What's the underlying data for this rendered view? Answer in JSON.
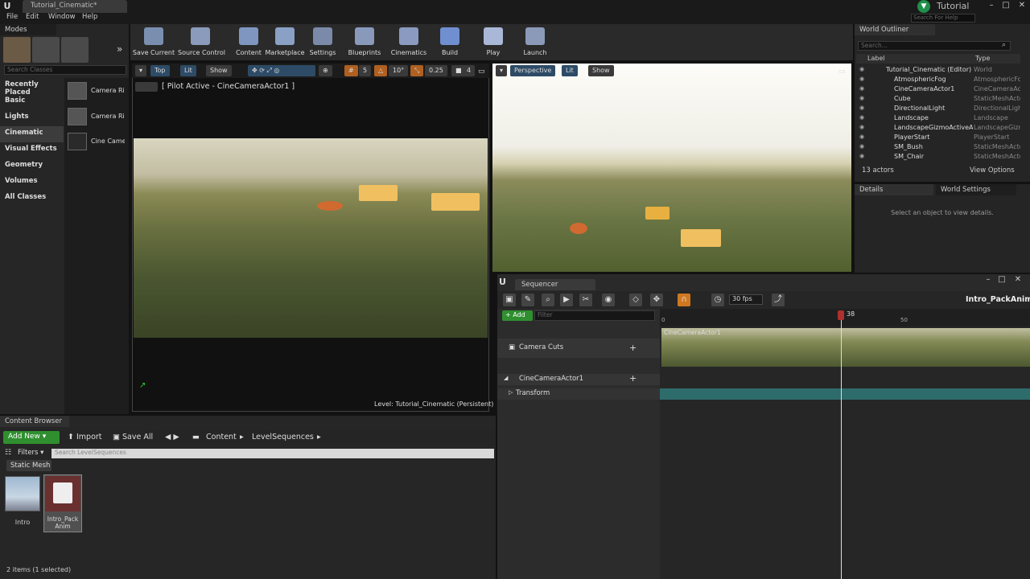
{
  "window": {
    "doc_tab": "Tutorial_Cinematic*",
    "project": "Tutorial",
    "help_search": "Search For Help"
  },
  "menus": [
    "File",
    "Edit",
    "Window",
    "Help"
  ],
  "modes": {
    "title": "Modes",
    "search_placeholder": "Search Classes",
    "categories": [
      "Recently Placed",
      "Basic",
      "Lights",
      "Cinematic",
      "Visual Effects",
      "Geometry",
      "Volumes",
      "All Classes"
    ],
    "selected_category": "Cinematic",
    "items": [
      "Camera Ri",
      "Camera Ri",
      "Cine Came"
    ]
  },
  "toolbar": [
    "Save Current",
    "Source Control",
    "Content",
    "Marketplace",
    "Settings",
    "Blueprints",
    "Cinematics",
    "Build",
    "Play",
    "Launch"
  ],
  "viewport1": {
    "buttons": [
      "Top",
      "Lit",
      "Show"
    ],
    "grid": "5",
    "angle": "10°",
    "scale": "0.25",
    "cam_speed": "4",
    "pilot_label": "[ Pilot Active - CineCameraActor1 ]",
    "level_label": "Level:  Tutorial_Cinematic (Persistent)"
  },
  "viewport2": {
    "buttons": [
      "Perspective",
      "Lit",
      "Show"
    ]
  },
  "outliner": {
    "title": "World Outliner",
    "search_placeholder": "Search...",
    "col_label": "Label",
    "col_type": "Type",
    "rows": [
      {
        "name": "Tutorial_Cinematic (Editor)",
        "type": "World"
      },
      {
        "name": "AtmosphericFog",
        "type": "AtmosphericFog"
      },
      {
        "name": "CineCameraActor1",
        "type": "CineCameraActor"
      },
      {
        "name": "Cube",
        "type": "StaticMeshActor"
      },
      {
        "name": "DirectionalLight",
        "type": "DirectionalLight"
      },
      {
        "name": "Landscape",
        "type": "Landscape"
      },
      {
        "name": "LandscapeGizmoActiveActor",
        "type": "LandscapeGizmo"
      },
      {
        "name": "PlayerStart",
        "type": "PlayerStart"
      },
      {
        "name": "SM_Bush",
        "type": "StaticMeshActor"
      },
      {
        "name": "SM_Chair",
        "type": "StaticMeshActor"
      }
    ],
    "actor_count": "13 actors",
    "view_options": "View Options"
  },
  "details": {
    "tab1": "Details",
    "tab2": "World Settings",
    "message": "Select an object to view details."
  },
  "sequencer": {
    "title": "Sequencer",
    "fps": "30 fps",
    "sequence_name": "Intro_PackAnim",
    "add_label": "Add",
    "filter_placeholder": "Filter",
    "tracks": [
      "Camera Cuts",
      "CineCameraActor1",
      "Transform"
    ],
    "cam_strip_label": "CineCameraActor1",
    "ruler": {
      "start": "0",
      "mark": "50"
    },
    "current_frame": "38"
  },
  "content_browser": {
    "title": "Content Browser",
    "add_new": "Add New",
    "import": "Import",
    "save_all": "Save All",
    "path": [
      "Content",
      "LevelSequences"
    ],
    "filters": "Filters",
    "search_placeholder": "Search LevelSequences",
    "filter_chip": "Static Mesh",
    "assets": [
      "Intro",
      "Intro_Pack Anim"
    ],
    "status": "2 items (1 selected)"
  },
  "colors": {
    "accent_green": "#2f8f2f",
    "playhead": "#b03030",
    "transform_track": "#2e6b6b",
    "selected_blue": "#2d4b66"
  }
}
